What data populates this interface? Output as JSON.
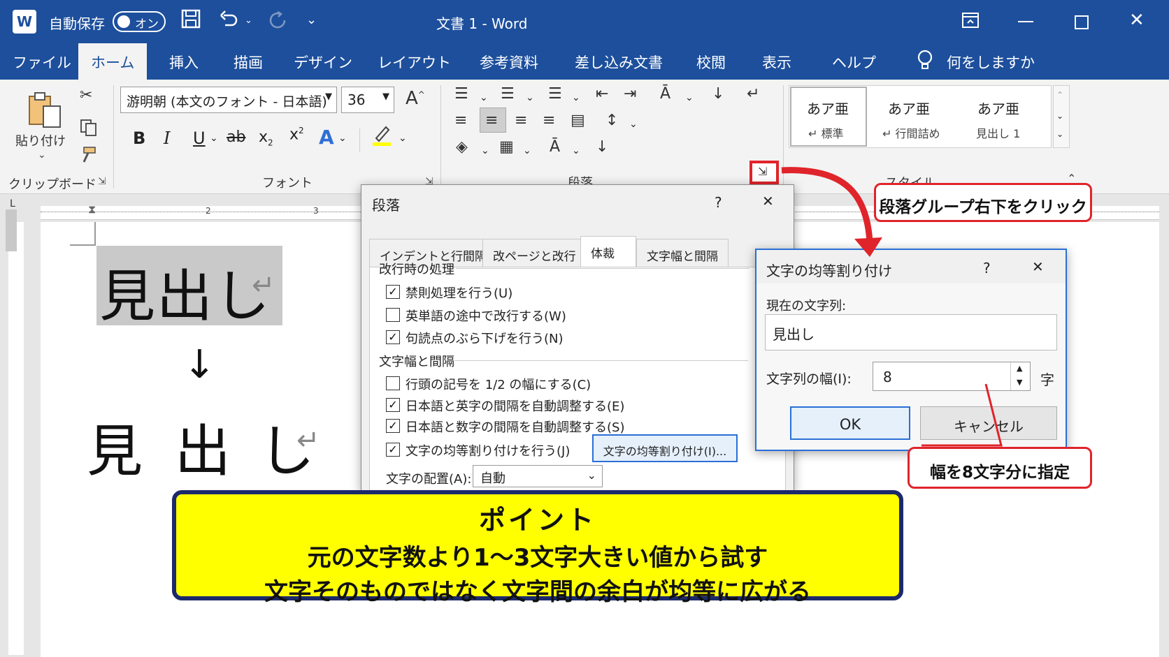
{
  "titlebar": {
    "app_icon": "W",
    "autosave_label": "自動保存",
    "autosave_state": "オン",
    "document_title": "文書 1 - Word",
    "icons": [
      "save-icon",
      "undo-icon",
      "redo-icon",
      "customize-icon",
      "ribbon-display-icon",
      "minimize-icon",
      "maximize-icon",
      "close-icon"
    ]
  },
  "tabs": [
    "ファイル",
    "ホーム",
    "挿入",
    "描画",
    "デザイン",
    "レイアウト",
    "参考資料",
    "差し込み文書",
    "校閲",
    "表示",
    "ヘルプ"
  ],
  "tell_me": "何をしますか",
  "ribbon": {
    "paste_label": "貼り付け",
    "clipboard_group": "クリップボード",
    "font_name": "游明朝 (本文のフォント - 日本語)",
    "font_size": "36",
    "font_group": "フォント",
    "paragraph_group": "段落",
    "styles_group": "スタイル",
    "styles": [
      {
        "preview": "あア亜",
        "name": "↵ 標準"
      },
      {
        "preview": "あア亜",
        "name": "↵ 行間詰め"
      },
      {
        "preview": "あア亜",
        "name": "見出し 1"
      }
    ]
  },
  "document": {
    "before_text": "見出し",
    "arrow": "↓",
    "after_chars": [
      "見",
      "出",
      "し"
    ],
    "para_mark": "↵"
  },
  "paragraph_dialog": {
    "title": "段落",
    "help": "?",
    "close": "✕",
    "tabs": [
      "インデントと行間隔",
      "改ページと改行",
      "体裁",
      "文字幅と間隔"
    ],
    "active_tab": "体裁",
    "section1": "改行時の処理",
    "options1": [
      {
        "label": "禁則処理を行う(U)",
        "checked": true
      },
      {
        "label": "英単語の途中で改行する(W)",
        "checked": false
      },
      {
        "label": "句読点のぶら下げを行う(N)",
        "checked": true
      }
    ],
    "section2": "文字幅と間隔",
    "options2": [
      {
        "label": "行頭の記号を 1/2 の幅にする(C)",
        "checked": false
      },
      {
        "label": "日本語と英字の間隔を自動調整する(E)",
        "checked": true
      },
      {
        "label": "日本語と数字の間隔を自動調整する(S)",
        "checked": true
      },
      {
        "label": "文字の均等割り付けを行う(J)",
        "checked": true
      }
    ],
    "distribute_button": "文字の均等割り付け(I)...",
    "align_label": "文字の配置(A):",
    "align_value": "自動"
  },
  "fit_dialog": {
    "title": "文字の均等割り付け",
    "help": "?",
    "close": "✕",
    "current_label": "現在の文字列:",
    "current_value": "見出し",
    "width_label": "文字列の幅(I):",
    "width_value": "8",
    "unit": "字",
    "ok": "OK",
    "cancel": "キャンセル"
  },
  "callouts": {
    "click_group": "段落グループ右下をクリック",
    "width_spec": "幅を8文字分に指定"
  },
  "point_box": {
    "heading": "ポイント",
    "line1": "元の文字数より1～3文字大きい値から試す",
    "line2": "文字そのものではなく文字間の余白が均等に広がる"
  },
  "colors": {
    "word_blue": "#1d4f9c",
    "callout_red": "#e0242b",
    "point_yellow": "#ffff00",
    "point_border": "#1c2a6b"
  }
}
